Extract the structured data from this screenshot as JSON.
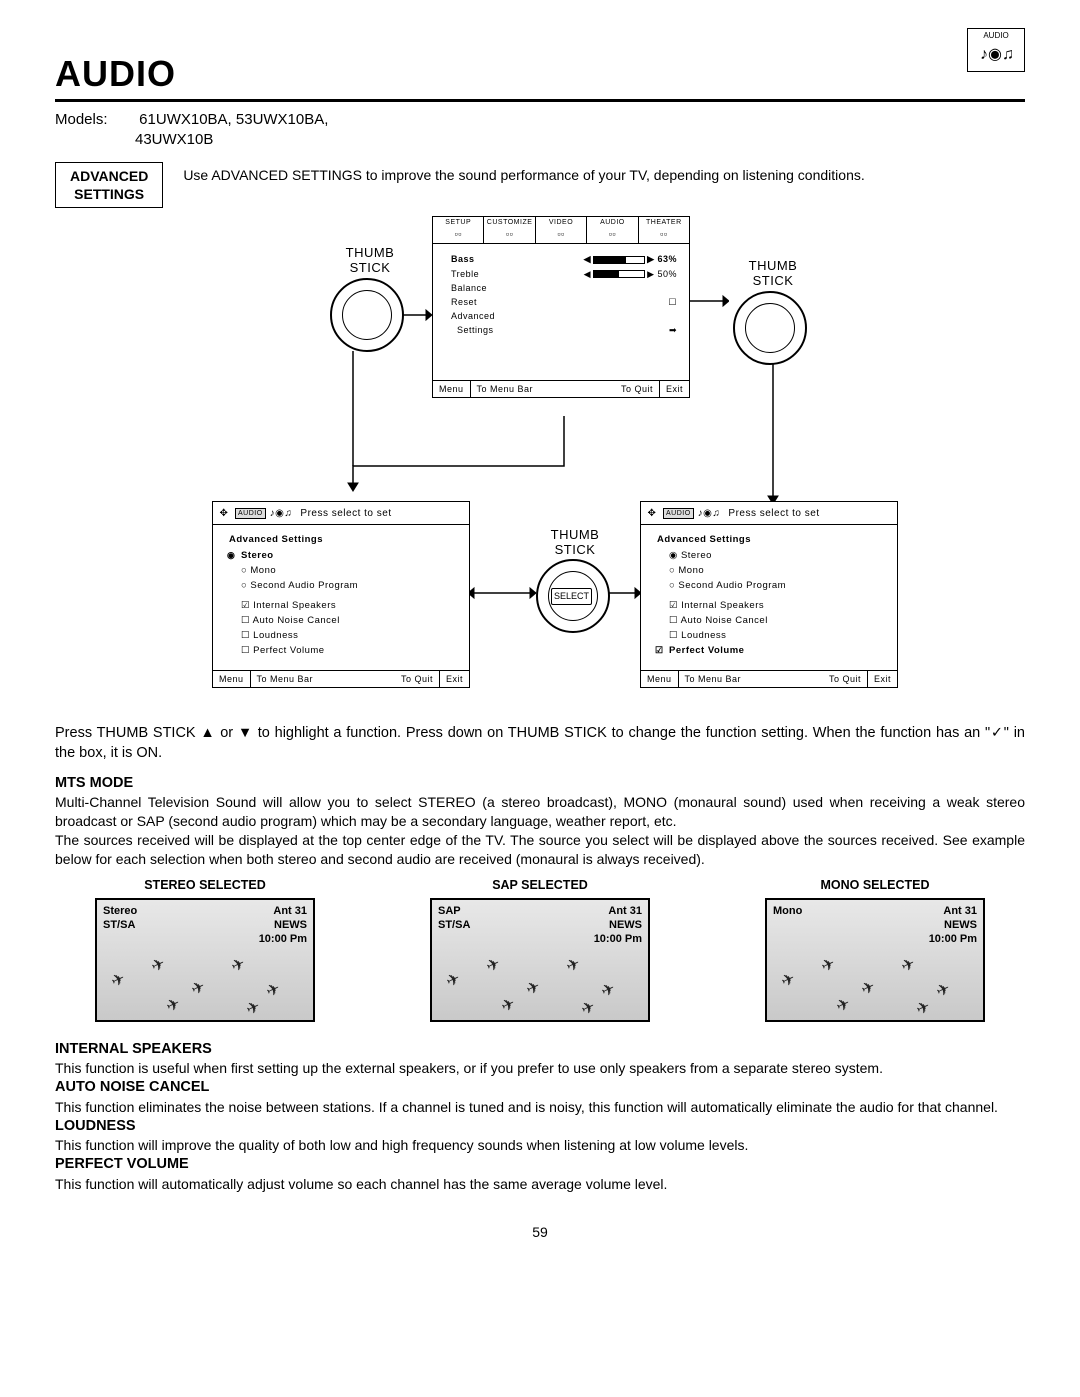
{
  "page_number": "59",
  "title": "AUDIO",
  "corner_label": "AUDIO",
  "models_label": "Models:",
  "models_line1": "61UWX10BA, 53UWX10BA,",
  "models_line2": "43UWX10B",
  "adv_box_l1": "ADVANCED",
  "adv_box_l2": "SETTINGS",
  "adv_text": "Use ADVANCED SETTINGS to improve the sound performance of your TV, depending on listening conditions.",
  "thumb_label": "THUMB\nSTICK",
  "select_label": "SELECT",
  "osd1": {
    "tabs": [
      "SETUP",
      "CUSTOMIZE",
      "VIDEO",
      "AUDIO",
      "THEATER"
    ],
    "rows": [
      {
        "l": "Bass",
        "r": "63%",
        "bold": true
      },
      {
        "l": "Treble",
        "r": "50%"
      },
      {
        "l": "Balance",
        "r": ""
      },
      {
        "l": "Reset",
        "r": "☐"
      },
      {
        "l": "Advanced",
        "r": ""
      },
      {
        "l": "  Settings",
        "r": "➡"
      }
    ],
    "footer": [
      "Menu",
      "To Menu Bar",
      "To Quit",
      "Exit"
    ]
  },
  "osd2_header_label": "AUDIO",
  "osd2_header_text": "Press select to set",
  "osd2_left": {
    "title": "Advanced Settings",
    "items": [
      {
        "t": "Stereo",
        "k": "radio",
        "sel": true,
        "ptr": true,
        "bold": true
      },
      {
        "t": "Mono",
        "k": "radio"
      },
      {
        "t": "Second Audio Program",
        "k": "radio"
      },
      {
        "t": "Internal Speakers",
        "k": "chk",
        "sel": true,
        "gap": true
      },
      {
        "t": "Auto Noise Cancel",
        "k": "chk"
      },
      {
        "t": "Loudness",
        "k": "chk"
      },
      {
        "t": "Perfect Volume",
        "k": "chk"
      }
    ]
  },
  "osd2_right": {
    "title": "Advanced Settings",
    "items": [
      {
        "t": "Stereo",
        "k": "radio",
        "sel": true
      },
      {
        "t": "Mono",
        "k": "radio"
      },
      {
        "t": "Second Audio Program",
        "k": "radio"
      },
      {
        "t": "Internal Speakers",
        "k": "chk",
        "sel": true,
        "gap": true
      },
      {
        "t": "Auto Noise Cancel",
        "k": "chk"
      },
      {
        "t": "Loudness",
        "k": "chk"
      },
      {
        "t": "Perfect Volume",
        "k": "chk",
        "sel": true,
        "ptr": true,
        "bold": true
      }
    ]
  },
  "osd2_footer": [
    "Menu",
    "To Menu Bar",
    "To Quit",
    "Exit"
  ],
  "instruction_para": "Press THUMB STICK ▲ or ▼ to highlight a function. Press down on THUMB STICK to change the function setting. When the function has an \"✓\" in the box, it is ON.",
  "mts": {
    "head": "MTS MODE",
    "p1": "Multi-Channel Television Sound will allow you to select STEREO (a stereo broadcast), MONO (monaural sound) used when receiving a weak stereo broadcast or SAP (second audio program) which may be a secondary language, weather report, etc.",
    "p2": "The sources received will be displayed at the top center edge of the TV.  The source you select will be displayed above the sources received.  See example below for each selection when both stereo and second audio are received (monaural is always received)."
  },
  "tvs": [
    {
      "cap": "STEREO SELECTED",
      "mode": "Stereo",
      "sub": "ST/SA",
      "ant": "Ant   31",
      "news": "NEWS",
      "time": "10:00 Pm"
    },
    {
      "cap": "SAP SELECTED",
      "mode": "SAP",
      "sub": "ST/SA",
      "ant": "Ant   31",
      "news": "NEWS",
      "time": "10:00 Pm"
    },
    {
      "cap": "MONO SELECTED",
      "mode": "Mono",
      "sub": "",
      "ant": "Ant   31",
      "news": "NEWS",
      "time": "10:00 Pm"
    }
  ],
  "sections": [
    {
      "h": "INTERNAL SPEAKERS",
      "b": "This function is useful when first setting up the external speakers, or if you prefer to use only speakers from a separate stereo system."
    },
    {
      "h": "AUTO NOISE CANCEL",
      "b": "This function eliminates the noise between stations. If a channel is tuned and is noisy, this function will automatically eliminate the audio for that channel."
    },
    {
      "h": "LOUDNESS",
      "b": "This function will improve the quality of both low and high frequency sounds when listening at low volume levels."
    },
    {
      "h": "PERFECT VOLUME",
      "b": "This function will automatically adjust volume so each channel has the same average volume level."
    }
  ]
}
